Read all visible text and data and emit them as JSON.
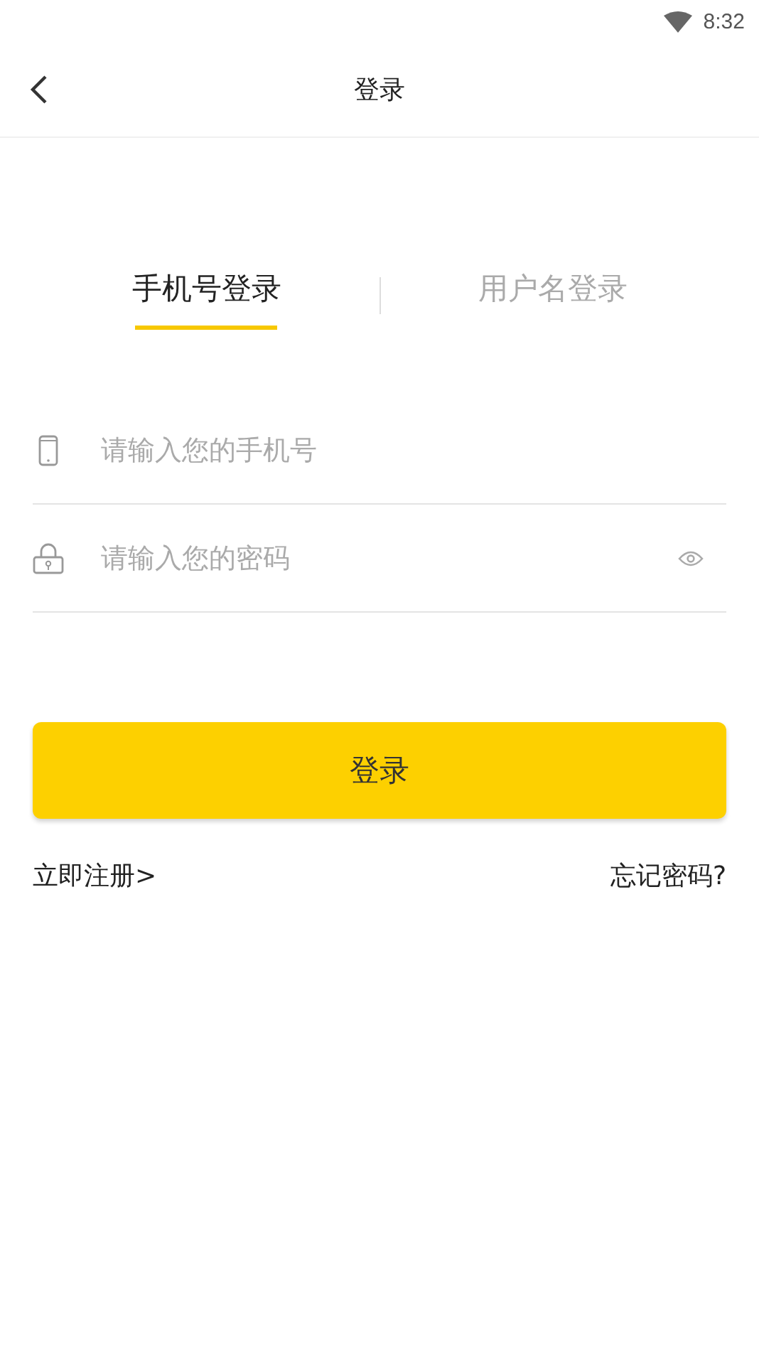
{
  "status_bar": {
    "time": "8:32"
  },
  "header": {
    "title": "登录"
  },
  "tabs": [
    {
      "label": "手机号登录",
      "selected": true
    },
    {
      "label": "用户名登录",
      "selected": false
    }
  ],
  "fields": [
    {
      "kind": "phone",
      "placeholder": "请输入您的手机号"
    },
    {
      "kind": "password",
      "placeholder": "请输入您的密码"
    }
  ],
  "login_button": "登录",
  "links": {
    "register": "立即注册>",
    "forgot": "忘记密码?"
  }
}
